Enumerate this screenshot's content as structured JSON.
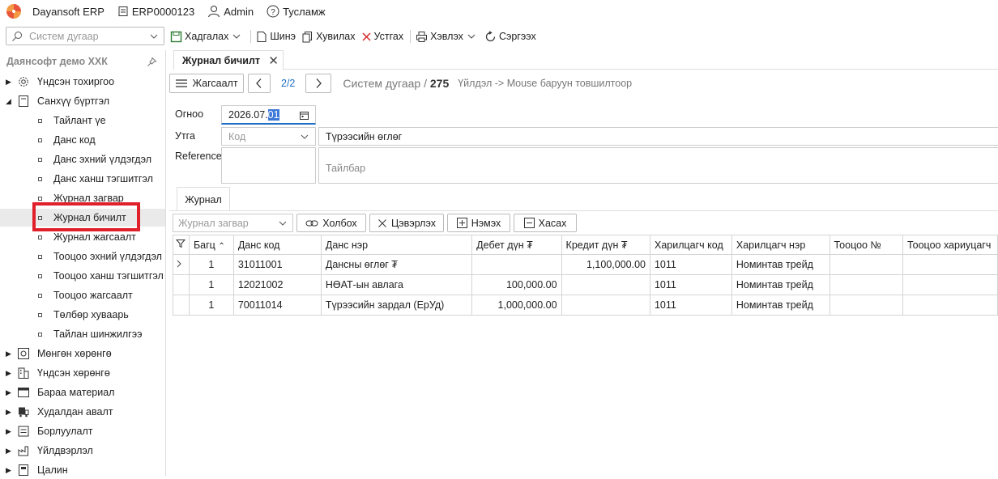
{
  "topbar": {
    "app_name": "Dayansoft ERP",
    "database": "ERP0000123",
    "user": "Admin",
    "help": "Тусламж"
  },
  "search": {
    "placeholder": "Систем дугаар"
  },
  "toolbar": {
    "save": "Хадгалах",
    "new": "Шинэ",
    "copy": "Хувилах",
    "delete": "Устгах",
    "print": "Хэвлэх",
    "refresh": "Сэргээх"
  },
  "sidebar": {
    "company": "Даянсофт демо ХХК",
    "items": [
      {
        "label": "Үндсэн тохиргоо",
        "level": 1,
        "icon": "gear-icon",
        "expanded": false
      },
      {
        "label": "Санхүү бүртгэл",
        "level": 1,
        "icon": "ledger-icon",
        "expanded": true
      },
      {
        "label": "Тайлант үе",
        "level": 2
      },
      {
        "label": "Данс код",
        "level": 2
      },
      {
        "label": "Данс эхний үлдэгдэл",
        "level": 2
      },
      {
        "label": "Данс ханш тэгшитгэл",
        "level": 2
      },
      {
        "label": "Журнал загвар",
        "level": 2
      },
      {
        "label": "Журнал бичилт",
        "level": 2,
        "selected": true
      },
      {
        "label": "Журнал жагсаалт",
        "level": 2
      },
      {
        "label": "Тооцоо эхний үлдэгдэл",
        "level": 2
      },
      {
        "label": "Тооцоо ханш тэгшитгэл",
        "level": 2
      },
      {
        "label": "Тооцоо жагсаалт",
        "level": 2
      },
      {
        "label": "Төлбөр хуваарь",
        "level": 2
      },
      {
        "label": "Тайлан шинжилгээ",
        "level": 2
      },
      {
        "label": "Мөнгөн хөрөнгө",
        "level": 1,
        "icon": "safe-icon",
        "expanded": false
      },
      {
        "label": "Үндсэн хөрөнгө",
        "level": 1,
        "icon": "building-icon",
        "expanded": false
      },
      {
        "label": "Бараа материал",
        "level": 1,
        "icon": "inventory-icon",
        "expanded": false
      },
      {
        "label": "Худалдан авалт",
        "level": 1,
        "icon": "truck-icon",
        "expanded": false
      },
      {
        "label": "Борлуулалт",
        "level": 1,
        "icon": "cart-icon",
        "expanded": false
      },
      {
        "label": "Үйлдвэрлэл",
        "level": 1,
        "icon": "factory-icon",
        "expanded": false
      },
      {
        "label": "Цалин",
        "level": 1,
        "icon": "payroll-icon",
        "expanded": false
      }
    ]
  },
  "tab": {
    "label": "Журнал бичилт"
  },
  "nav": {
    "list_button": "Жагсаалт",
    "count": "2/2",
    "system_number_label": "Систем дугаар /",
    "system_number": "275",
    "hint": "Үйлдэл -> Mouse баруун товшилтоор"
  },
  "form": {
    "date_label": "Огноо",
    "date_prefix": "2026.07.",
    "date_selected": "01",
    "type_label": "Утга",
    "code_placeholder": "Код",
    "description": "Түрээсийн өглөг",
    "reference_label": "Reference",
    "note_placeholder": "Тайлбар"
  },
  "journal_tab": {
    "label": "Журнал"
  },
  "grid_tools": {
    "template_placeholder": "Журнал загвар",
    "link": "Холбох",
    "clear": "Цэвэрлэх",
    "add": "Нэмэх",
    "remove": "Хасах"
  },
  "grid": {
    "columns": [
      "Багц",
      "Данс код",
      "Данс нэр",
      "Дебет дүн ₮",
      "Кредит дүн ₮",
      "Харилцагч код",
      "Харилцагч нэр",
      "Тооцоо №",
      "Тооцоо хариуцагч"
    ],
    "rows": [
      {
        "batch": "1",
        "account_code": "31011001",
        "account_name": "Дансны өглөг ₮",
        "debit": "",
        "credit": "1,100,000.00",
        "partner_code": "1011",
        "partner_name": "Номинтав трейд",
        "settlement_no": "",
        "responsible": ""
      },
      {
        "batch": "1",
        "account_code": "12021002",
        "account_name": "НӨАТ-ын авлага",
        "debit": "100,000.00",
        "credit": "",
        "partner_code": "1011",
        "partner_name": "Номинтав трейд",
        "settlement_no": "",
        "responsible": ""
      },
      {
        "batch": "1",
        "account_code": "70011014",
        "account_name": "Түрээсийн зардал (ЕрУд)",
        "debit": "1,000,000.00",
        "credit": "",
        "partner_code": "1011",
        "partner_name": "Номинтав трейд",
        "settlement_no": "",
        "responsible": ""
      }
    ]
  }
}
